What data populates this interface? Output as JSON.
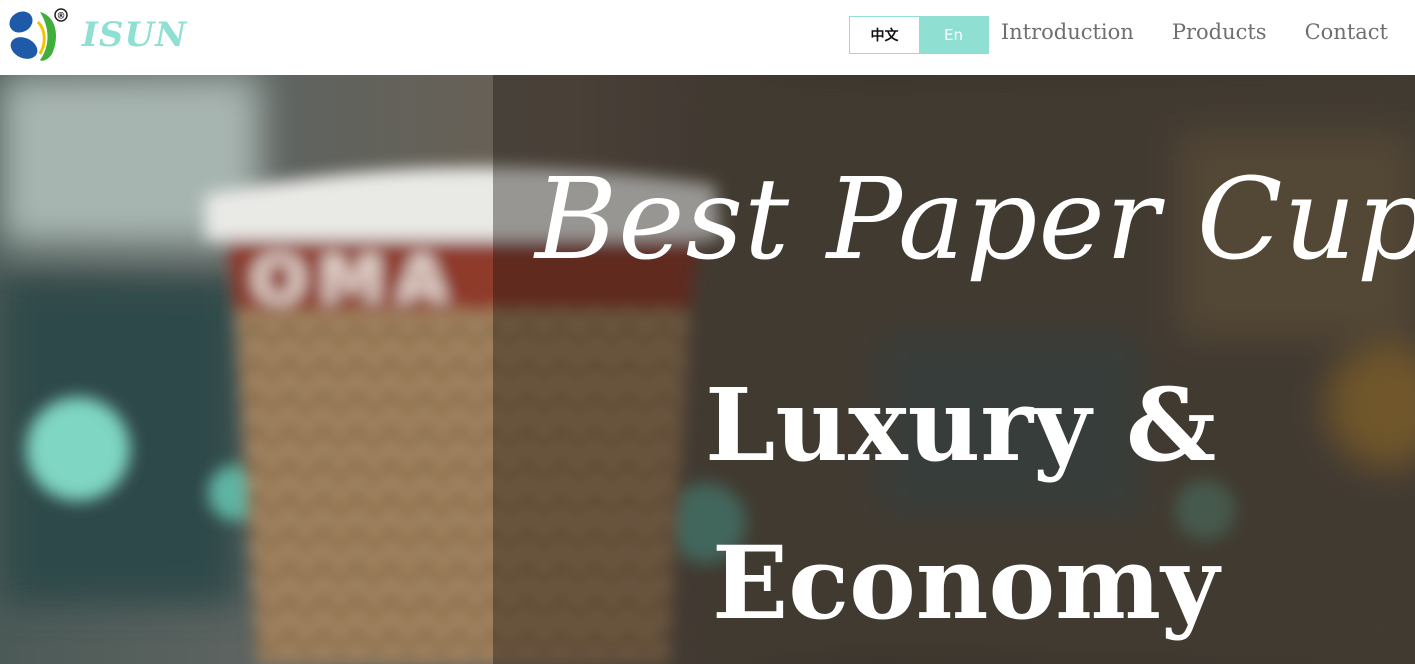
{
  "header": {
    "brand": "ISUN",
    "logo_mark": "®",
    "lang": {
      "zh_label": "中文",
      "en_label": "En",
      "active": "En"
    },
    "nav": [
      {
        "label": "Introduction"
      },
      {
        "label": "Products"
      },
      {
        "label": "Contact"
      }
    ]
  },
  "hero": {
    "line1": "Best Paper Cups",
    "line2": "Luxury &",
    "line3": "Economy",
    "cup_print": "OMA"
  },
  "colors": {
    "accent": "#8fe0d2",
    "logo_blue": "#1e5aa8",
    "logo_green": "#3fae3a",
    "nav_text": "#6f6f6f"
  },
  "icons": {
    "logo": "isun-logo-icon",
    "registered": "registered-mark-icon"
  }
}
